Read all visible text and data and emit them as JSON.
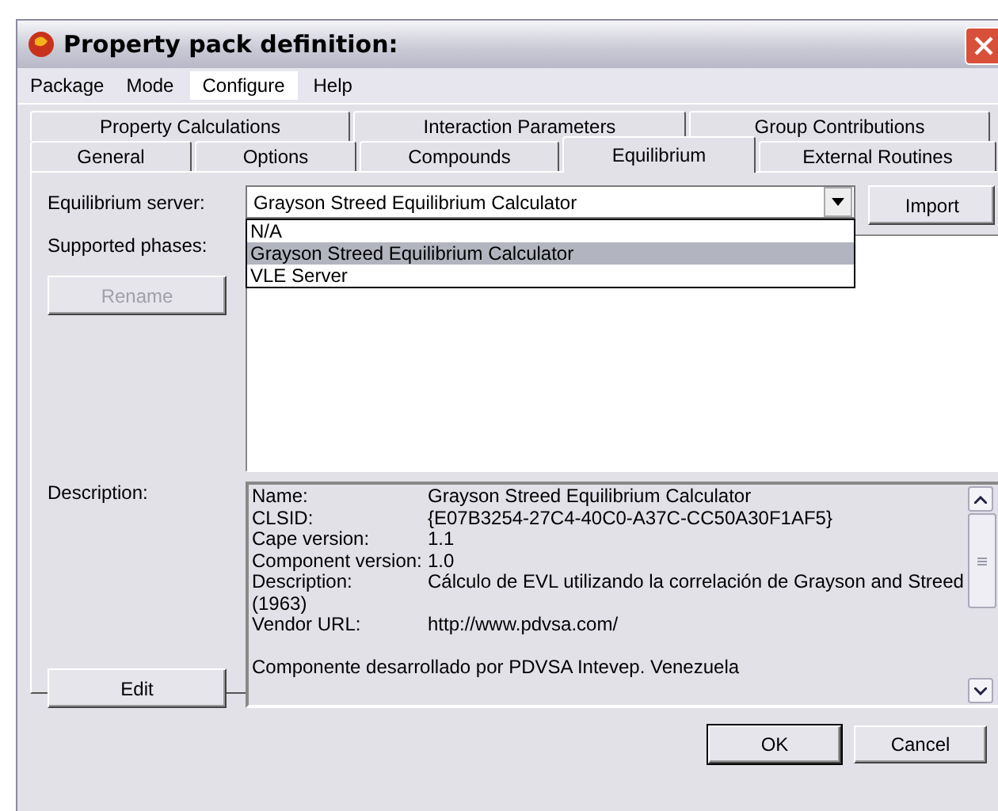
{
  "window": {
    "title": "Property pack definition:"
  },
  "menu": [
    {
      "label": "Package",
      "selected": false
    },
    {
      "label": "Mode",
      "selected": false
    },
    {
      "label": "Configure",
      "selected": true
    },
    {
      "label": "Help",
      "selected": false
    }
  ],
  "tab_rows": [
    [
      {
        "label": "Property Calculations",
        "selected": false
      },
      {
        "label": "Interaction Parameters",
        "selected": false
      },
      {
        "label": "Group Contributions",
        "selected": false
      }
    ],
    [
      {
        "label": "General",
        "selected": false
      },
      {
        "label": "Options",
        "selected": false
      },
      {
        "label": "Compounds",
        "selected": false
      },
      {
        "label": "Equilibrium",
        "selected": true
      },
      {
        "label": "External Routines",
        "selected": false
      }
    ]
  ],
  "equilibrium_server": {
    "label": "Equilibrium server:",
    "value": "Grayson Streed Equilibrium Calculator",
    "expanded": true,
    "options": [
      {
        "label": "N/A",
        "selected": false
      },
      {
        "label": "Grayson Streed Equilibrium Calculator",
        "selected": true
      },
      {
        "label": "VLE Server",
        "selected": false
      }
    ]
  },
  "import_button": "Import",
  "supported_phases": {
    "label": "Supported phases:"
  },
  "rename_button": {
    "label": "Rename",
    "disabled": true
  },
  "description": {
    "label": "Description:",
    "lines": [
      {
        "kind": "field",
        "label": "Name:",
        "value": "Grayson Streed Equilibrium Calculator"
      },
      {
        "kind": "field",
        "label": "CLSID:",
        "value": "{E07B3254-27C4-40C0-A37C-CC50A30F1AF5}"
      },
      {
        "kind": "field",
        "label": "Cape version:",
        "value": "1.1"
      },
      {
        "kind": "field",
        "label": "Component version:",
        "value": "1.0"
      },
      {
        "kind": "field",
        "label": "Description:",
        "value": "Cálculo de EVL utilizando la correlación de Grayson and Streed"
      },
      {
        "kind": "text",
        "text": "(1963)"
      },
      {
        "kind": "field",
        "label": "Vendor URL:",
        "value": "http://www.pdvsa.com/"
      },
      {
        "kind": "blank"
      },
      {
        "kind": "text",
        "text": "Componente desarrollado por PDVSA Intevep. Venezuela"
      }
    ]
  },
  "edit_button": "Edit",
  "buttons": [
    {
      "label": "OK",
      "default": true
    },
    {
      "label": "Cancel",
      "default": false
    }
  ]
}
